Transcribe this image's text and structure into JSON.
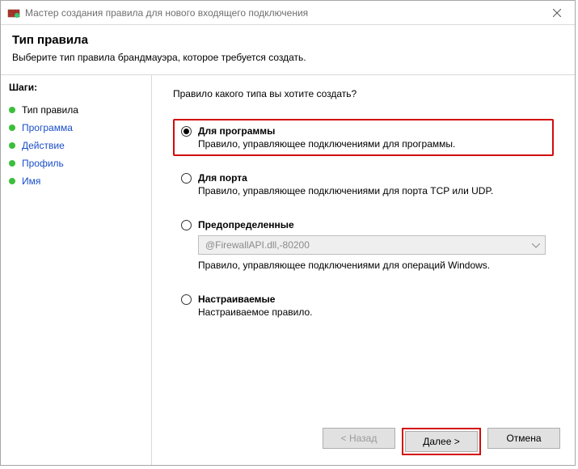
{
  "titlebar": {
    "title": "Мастер создания правила для нового входящего подключения"
  },
  "header": {
    "heading": "Тип правила",
    "subtitle": "Выберите тип правила брандмауэра, которое требуется создать."
  },
  "sidebar": {
    "steps_title": "Шаги:",
    "items": [
      {
        "label": "Тип правила"
      },
      {
        "label": "Программа"
      },
      {
        "label": "Действие"
      },
      {
        "label": "Профиль"
      },
      {
        "label": "Имя"
      }
    ]
  },
  "content": {
    "question": "Правило какого типа вы хотите создать?",
    "options": {
      "program": {
        "title": "Для программы",
        "desc": "Правило, управляющее подключениями для программы."
      },
      "port": {
        "title": "Для порта",
        "desc": "Правило, управляющее подключениями для порта TCP или UDP."
      },
      "predefined": {
        "title": "Предопределенные",
        "select_value": "@FirewallAPI.dll,-80200",
        "desc": "Правило, управляющее подключениями для операций Windows."
      },
      "custom": {
        "title": "Настраиваемые",
        "desc": "Настраиваемое правило."
      }
    }
  },
  "buttons": {
    "back": "< Назад",
    "next": "Далее >",
    "cancel": "Отмена"
  }
}
